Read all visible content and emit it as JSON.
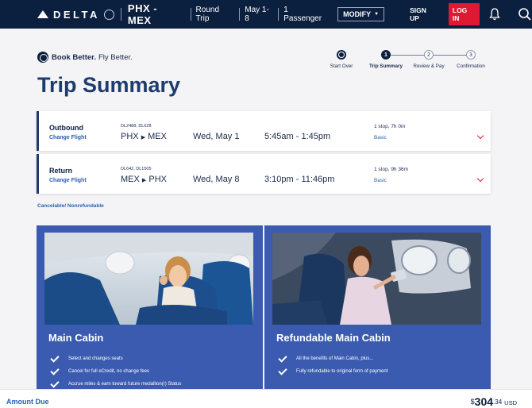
{
  "header": {
    "brand": "DELTA",
    "route": "PHX - MEX",
    "trip_type": "Round Trip",
    "dates": "May 1-8",
    "passengers": "1 Passenger",
    "modify": "MODIFY",
    "sign_up": "SIGN UP",
    "log_in": "LOG IN",
    "accent": "#e01933",
    "bg": "#0b1f3f"
  },
  "tagline": {
    "bold": "Book Better.",
    "rest": "Fly Better."
  },
  "page_title": "Trip Summary",
  "progress": {
    "start_over": "Start Over",
    "steps": [
      {
        "num": "1",
        "label": "Trip Summary"
      },
      {
        "num": "2",
        "label": "Review & Pay"
      },
      {
        "num": "3",
        "label": "Confirmation"
      }
    ]
  },
  "flights": [
    {
      "kind": "Outbound",
      "change": "Change Flight",
      "numbers": "DL2488, DL628",
      "from": "PHX",
      "to": "MEX",
      "date": "Wed, May 1",
      "time": "5:45am - 1:45pm",
      "stops": "1 stop, 7h 0m",
      "fare": "Basic"
    },
    {
      "kind": "Return",
      "change": "Change Flight",
      "numbers": "DL642, DL1505",
      "from": "MEX",
      "to": "PHX",
      "date": "Wed, May 8",
      "time": "3:10pm - 11:46pm",
      "stops": "1 stop, 9h 36m",
      "fare": "Basic"
    }
  ],
  "cancel_note": "Cancelable/ Nonrefundable",
  "cabins": [
    {
      "name": "Main Cabin",
      "features": [
        "Select and changes seats",
        "Cancel for full eCredit, no change fees",
        "Accrue miles & earn toward future medallion(r) Status"
      ]
    },
    {
      "name": "Refundable Main Cabin",
      "features": [
        "All the benefits of Main Cabin, plus...",
        "Fully refundable to original form of payment"
      ]
    }
  ],
  "footer": {
    "label": "Amount Due",
    "symbol": "$",
    "int": "304",
    "dec": ".34",
    "currency": "USD"
  }
}
